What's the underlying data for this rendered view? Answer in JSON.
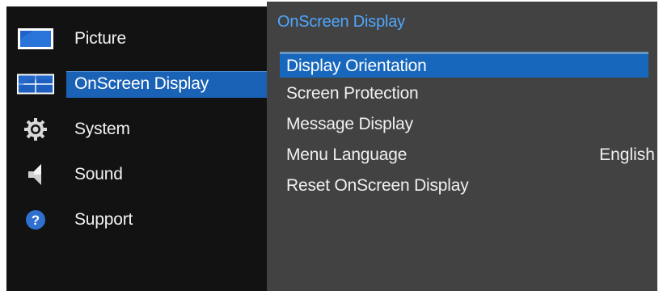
{
  "main_menu": {
    "items": [
      {
        "label": "Picture",
        "icon": "picture-icon"
      },
      {
        "label": "OnScreen Display",
        "icon": "onscreen-display-icon",
        "active": true
      },
      {
        "label": "System",
        "icon": "gear-icon"
      },
      {
        "label": "Sound",
        "icon": "speaker-icon"
      },
      {
        "label": "Support",
        "icon": "help-icon"
      }
    ]
  },
  "submenu": {
    "title": "OnScreen Display",
    "items": [
      {
        "label": "Display Orientation",
        "value": "",
        "selected": true
      },
      {
        "label": "Screen Protection",
        "value": ""
      },
      {
        "label": "Message Display",
        "value": ""
      },
      {
        "label": "Menu Language",
        "value": "English"
      },
      {
        "label": "Reset OnScreen Display",
        "value": ""
      }
    ]
  },
  "colors": {
    "background": "#121212",
    "submenu_background": "#424242",
    "accent": "#1a62b5",
    "title_blue": "#4ea7ff"
  }
}
